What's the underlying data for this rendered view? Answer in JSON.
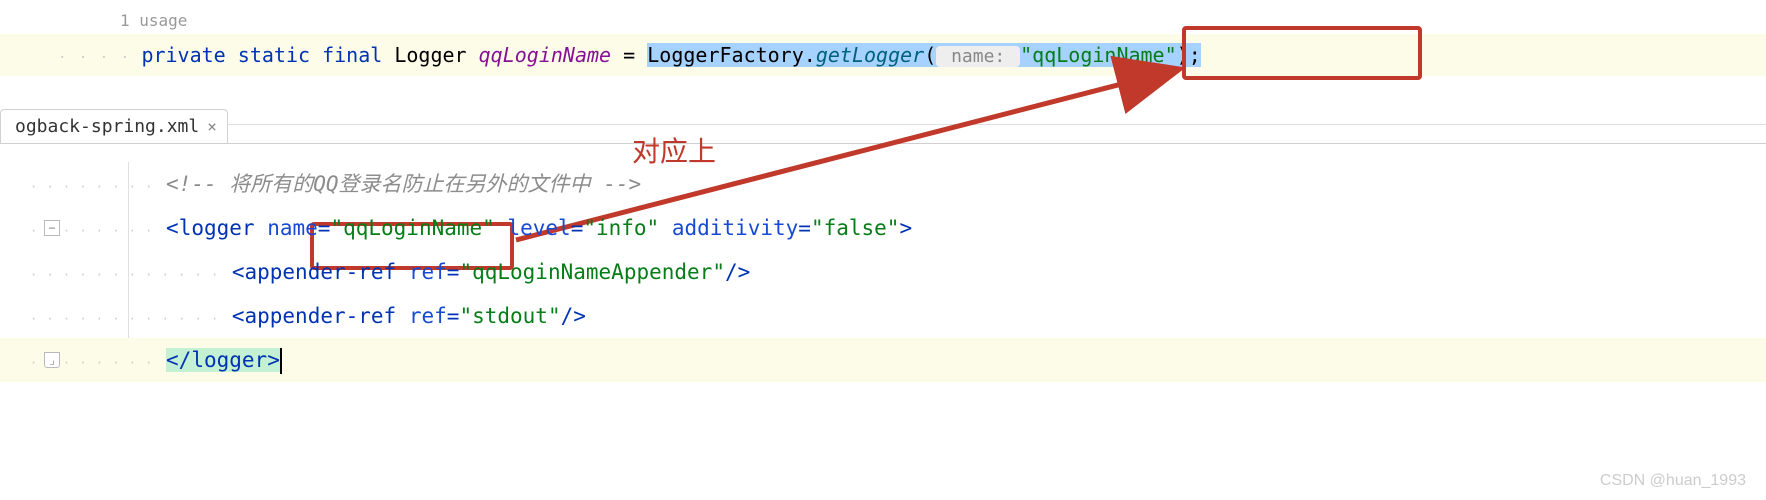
{
  "top_editor": {
    "usage": "1 usage",
    "kw_private": "private",
    "kw_static": "static",
    "kw_final": "final",
    "type": "Logger",
    "var": "qqLoginName",
    "eq": " = ",
    "factory": "LoggerFactory",
    "dot": ".",
    "method": "getLogger",
    "open": "(",
    "hint": " name: ",
    "string": "\"qqLoginName\"",
    "close": ")",
    "semi": ";"
  },
  "tab": {
    "name": "ogback-spring.xml",
    "close": "×"
  },
  "annotation": {
    "label": "对应上"
  },
  "xml": {
    "comment_open": "<!-- ",
    "comment_text": "将所有的QQ登录名防止在另外的文件中",
    "comment_close": " -->",
    "logger_open": "<",
    "logger_tag": "logger",
    "name_attr": "name",
    "name_val": "\"qqLoginName\"",
    "level_attr": "level",
    "level_val": "\"info\"",
    "additivity_attr": "additivity",
    "additivity_val": "\"false\"",
    "gt": ">",
    "appender_tag": "appender-ref",
    "ref_attr": "ref",
    "ref_val1": "\"qqLoginNameAppender\"",
    "ref_val2": "\"stdout\"",
    "selfclose": "/>",
    "logger_close_open": "</",
    "logger_close_tag": "logger",
    "logger_close_gt": ">"
  },
  "watermark": "CSDN @huan_1993"
}
